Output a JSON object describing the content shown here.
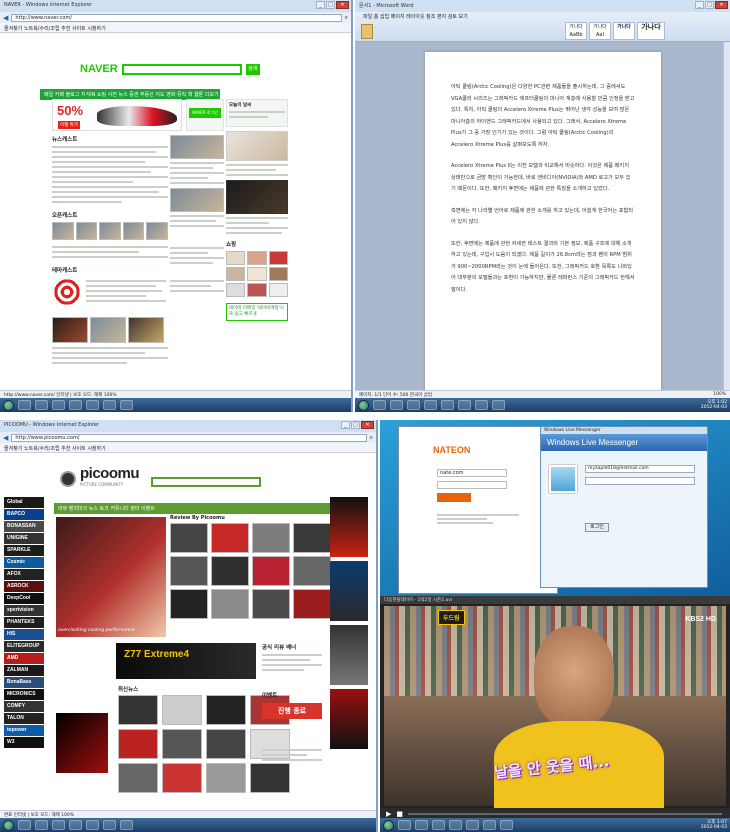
{
  "q1": {
    "title": "NAVER - Windows Internet Explorer",
    "address": "http://www.naver.com/",
    "bookmarks": "즐겨찾기   노트북/수리/조립   추천 사이트   시청하기",
    "tab": "NAVER",
    "logo": "NAVER",
    "search_button": "검색",
    "menu": "메일 카페 블로그 지식iN 쇼핑 사전 뉴스 증권 부동산 지도 영화 뮤직 책 웹툰 더보기",
    "promo_pct": "50%",
    "promo_label": "이월 특가",
    "login_label": "NAVER 로그인",
    "news_title": "뉴스캐스트",
    "open_title": "오픈캐스트",
    "theme_title": "테마캐스트",
    "shopping_title": "쇼핑",
    "today_title": "오늘의 날씨",
    "ad_text": "네이버 이메일 '네이버계정'으로 쉽고 빠르게",
    "status": "http://www.naver.com/  인터넷 | 보호 모드: 해제   100%",
    "clock_time": "오후 1:02",
    "clock_date": "2012-04-03"
  },
  "q2": {
    "title": "문서1 - Microsoft Word",
    "tabs": "파일 홈 삽입 페이지 레이아웃 참조 편지 검토 보기",
    "styles": [
      "가나다AaBb",
      "가나다AaI",
      "가나다",
      "가나다"
    ],
    "para1": "아틱 쿨링(Arctic Cooling)은 다양한 PC관련 제품들을 출시하는데, 그 중에서도 VGA쿨러 시리즈는 그래픽카드 애프터쿨링의 마니아 계층에 사용할 만큼 인정을 받고 있다. 특히, 아틱 쿨링의 Accelero Xtreme Plus는 뛰어난 냉각 성능을 보여 많은 마니아층의 하이엔드 그래픽카드에서 사용되고 있다. 그래서, Accelero Xtreme Plus가 그 중 가장 인기가 있는 것이다. 그럼 아틱 쿨링(Arctic Cooling)의 Accelero Xtreme Plus를 살펴보도록 하자.",
    "para2": "Accelero Xtreme Plus II는 이전 모델과 비교해서 비슷하다. 이것은 제품 패키지 상태만으로 금방 확인이 가능한데, 바로 엔비디아(NVIDIA)와 AMD 로고가 모두 있기 때문이다. 또한, 패키지 후면에는 제품에 관한 특징을 소개하고 있었다.",
    "para3": "측면에는 각 나라별 언어로 제품에 관한 소개를 하고 있는데, 아쉽게 한국어는 포함되어 있지 않다.",
    "para4": "또한, 후면에는 제품에 관한 자세한 테스트 결과와 기본 정보, 제품 구조에 대해 소개하고 있는데, 구입시 도움이 되겠다. 제품 길이가 26.8cm라는 점과 팬의 RPM 범위가 900~2000RPM라는 것이 눈에 들어온다. 또한, 그래픽카드 호환 목록도 나와있어 대부분의 모델들과는 호환이 가능하지만, 물론 레퍼런스 기준의 그래픽카드 한해서 말이다.",
    "status": "페이지: 1/1  단어 수: 500  한국어  삽입",
    "zoom": "100%",
    "clock_time": "오후 1:02",
    "clock_date": "2012-04-03"
  },
  "q3": {
    "title": "PICOOMU - Windows Internet Explorer",
    "address": "http://www.picoomu.com/",
    "bookmarks": "즐겨찾기   노트북/수리/조립   추천 사이트   시청하기",
    "logo": "picoomu",
    "logo_sub": "PICTURE COMMUNITY",
    "nav": "리뷰 벤치마크 뉴스 토크 커뮤니티 장터 이벤트",
    "side_banners": [
      "Global",
      "BAPCO",
      "BONASSAN",
      "UNIGINE",
      "SPARKLE",
      "Cosmic",
      "AFOX",
      "ASROCK",
      "DeepCool",
      "xpertvision",
      "PHANTEKS",
      "HIS",
      "ELITEGROUP",
      "AMD",
      "ZALMAN",
      "BonaBass",
      "MICRONICS",
      "COMFY",
      "TALON",
      "topower",
      "W3"
    ],
    "hero_caption": "overclocking cooling performance",
    "review_title": "Review By Picoomu",
    "asrock_title": "Z77 Extreme4",
    "sec_news": "최신뉴스",
    "sec_best": "공식 리뷰 배너",
    "sec_event": "이벤트",
    "event_badge": "진행 종료",
    "status": "완료  인터넷 | 보호 모드: 해제   100%",
    "clock_time": "오후 1:07",
    "clock_date": "2012-04-03"
  },
  "q4": {
    "nateon_title": "NATEON",
    "nateon_id": "nate.com",
    "msn_title": "Windows Live Messenger",
    "msn_window": "Windows Live Messenger",
    "msn_email": "myaaple018@hotmail.com",
    "msn_signin": "로그인",
    "player_title": "다음팟플레이어 - 1박2일 시즌2.avi",
    "channel": "KBS2 HD",
    "badge": "두드림",
    "subtitle": "날을 안 웃을 때...",
    "clock_time": "오후 1:07",
    "clock_date": "2012-04-03"
  }
}
